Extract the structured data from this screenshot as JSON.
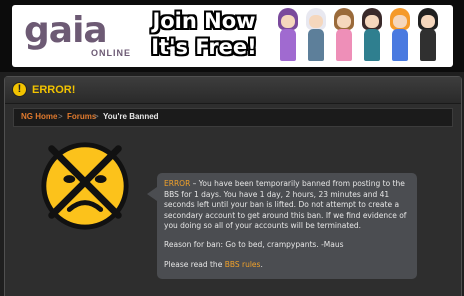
{
  "banner": {
    "logo_text": "gaia",
    "logo_subtext": "ONLINE",
    "join_line1": "Join Now",
    "join_line2": "It's Free!"
  },
  "avatars": [
    {
      "hair": "#7a4a9c",
      "outfit": "#a06ad0"
    },
    {
      "hair": "#e8e8f0",
      "outfit": "#5d7f9a"
    },
    {
      "hair": "#9a6a3a",
      "outfit": "#ee8fb8"
    },
    {
      "hair": "#3a2a2a",
      "outfit": "#2f7f8f"
    },
    {
      "hair": "#f59a2a",
      "outfit": "#4a7ae0"
    },
    {
      "hair": "#202020",
      "outfit": "#303030"
    }
  ],
  "header": {
    "title": "ERROR!",
    "icon": "warning-icon"
  },
  "breadcrumb": {
    "items": [
      "NG Home",
      "Forums",
      "You're Banned"
    ],
    "separator": ">"
  },
  "message": {
    "error_label": "ERROR",
    "body": " – You have been temporarily banned from posting to the BBS for 1 days. You have 1 day, 2 hours, 23 minutes and 41 seconds left until your ban is lifted. Do not attempt to create a secondary account to get around this ban. If we find evidence of you doing so all of your accounts will be terminated.",
    "reason": "Reason for ban: Go to bed, crampypants. -Maus",
    "read_prefix": "Please read the ",
    "rules_link": "BBS rules",
    "read_suffix": "."
  },
  "colors": {
    "accent": "#f2a22a",
    "title_yellow": "#f2c300",
    "link_orange": "#e07a2e",
    "panel_bg": "#2e2e2e",
    "message_bg": "#4b4d51"
  }
}
